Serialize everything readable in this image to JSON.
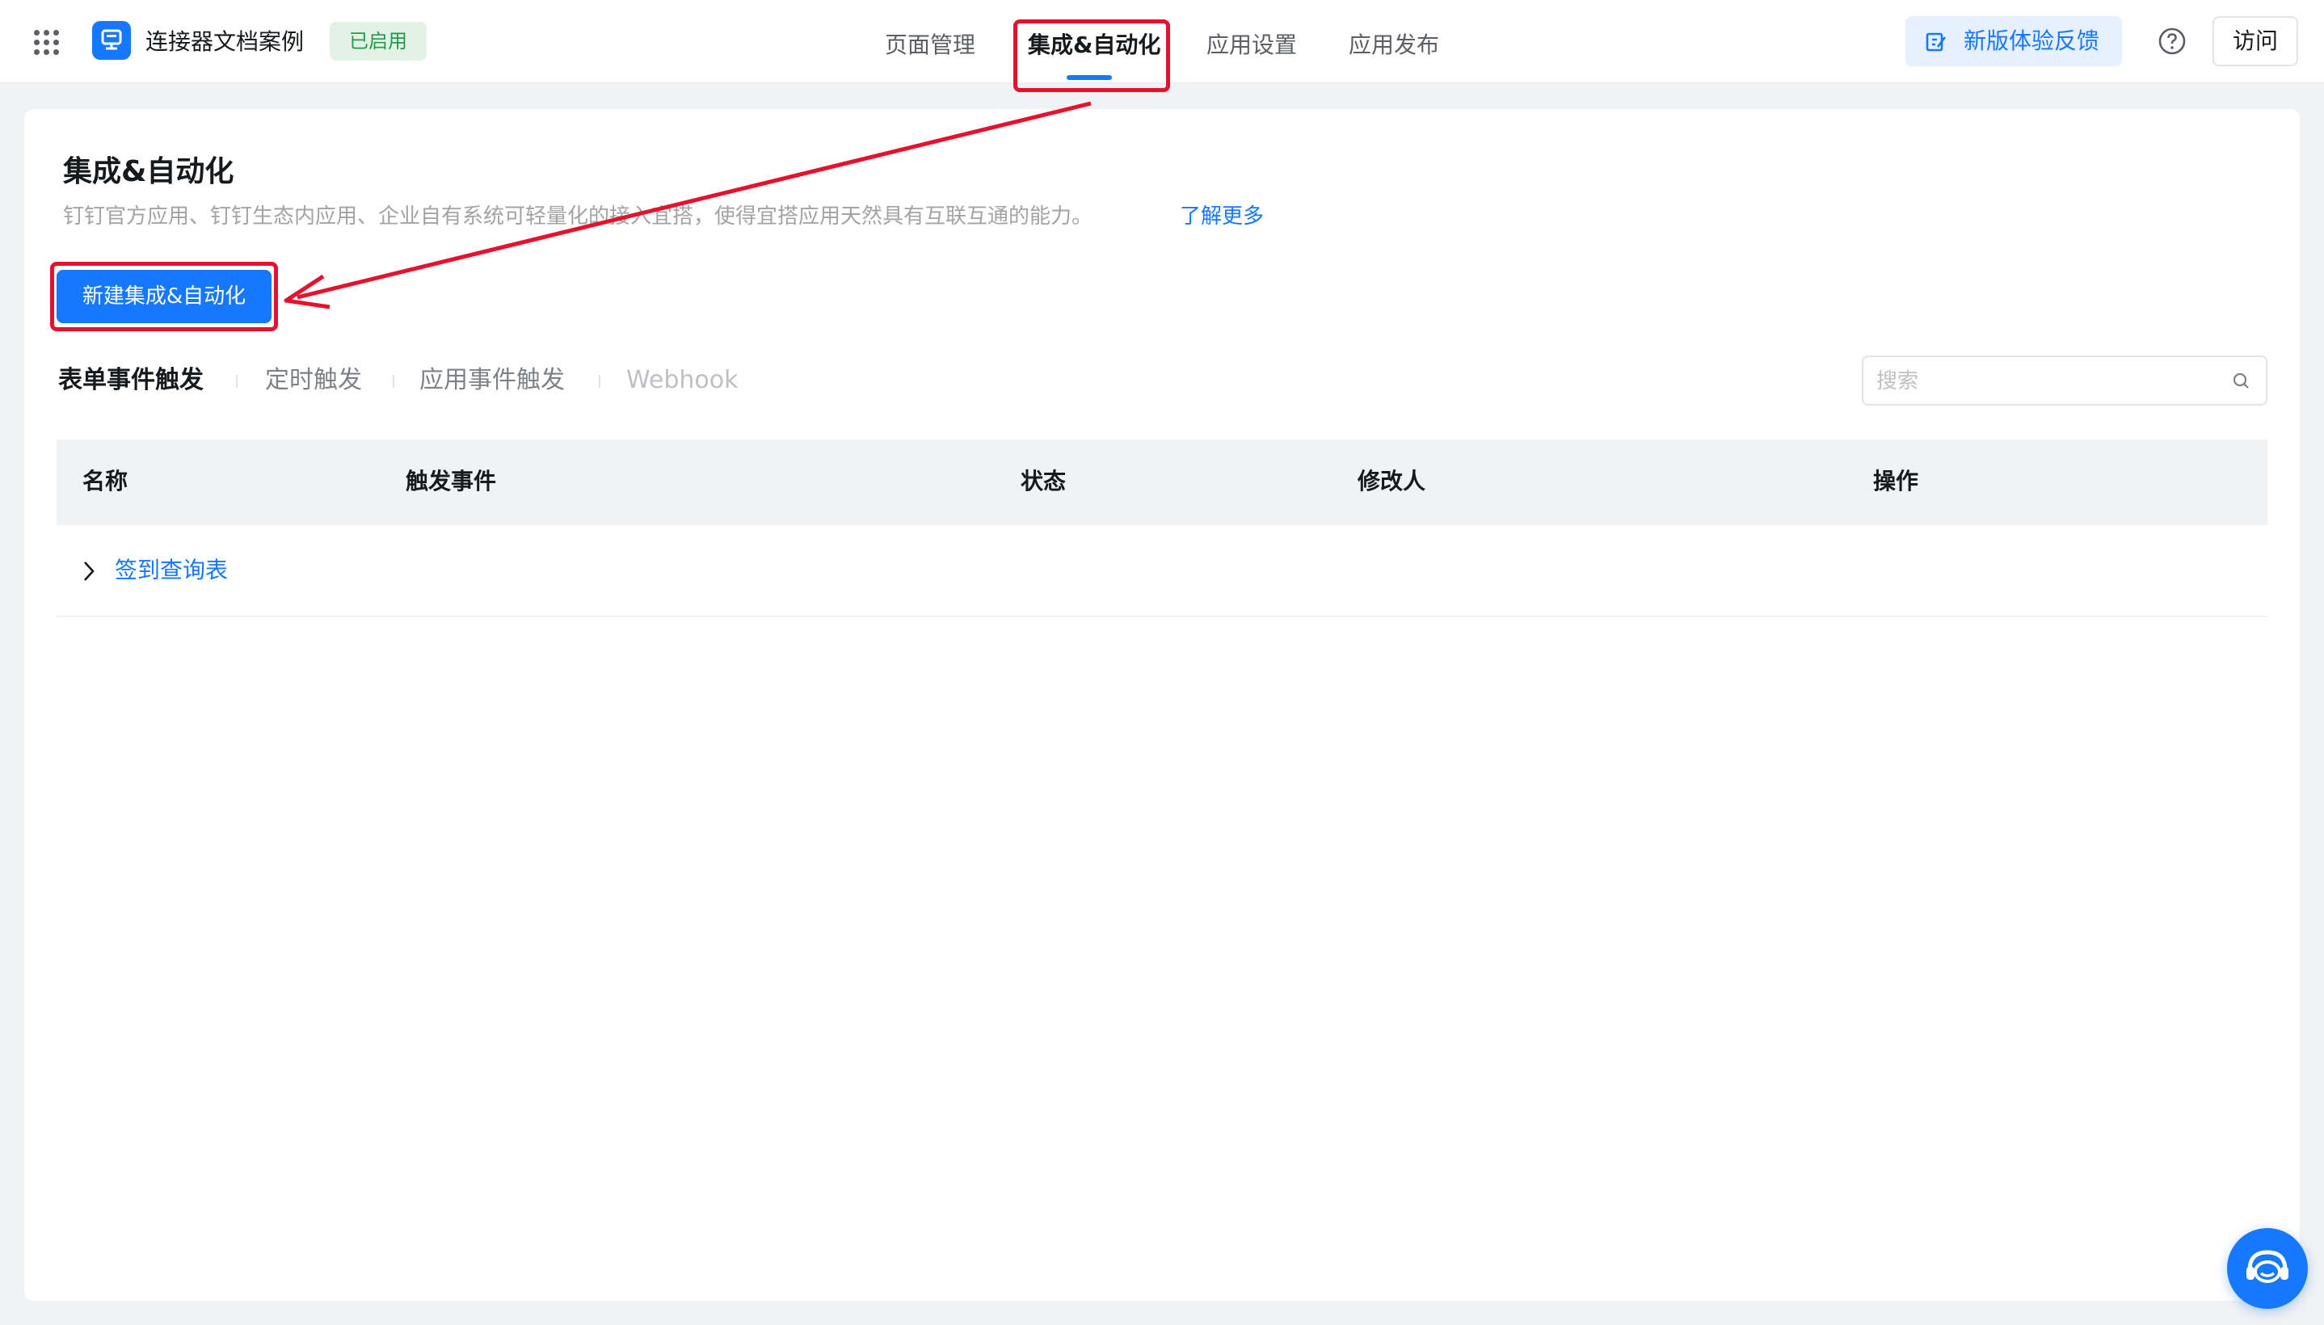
{
  "header": {
    "app_name": "连接器文档案例",
    "status_badge": "已启用",
    "nav_tabs": [
      {
        "label": "页面管理",
        "active": false
      },
      {
        "label": "集成&自动化",
        "active": true
      },
      {
        "label": "应用设置",
        "active": false
      },
      {
        "label": "应用发布",
        "active": false
      }
    ],
    "feedback_label": "新版体验反馈",
    "visit_label": "访问"
  },
  "main": {
    "title": "集成&自动化",
    "description": "钉钉官方应用、钉钉生态内应用、企业自有系统可轻量化的接入宜搭，使得宜搭应用天然具有互联互通的能力。",
    "learn_more": "了解更多",
    "create_button": "新建集成&自动化",
    "sub_tabs": [
      {
        "label": "表单事件触发",
        "state": "active"
      },
      {
        "label": "定时触发",
        "state": "normal"
      },
      {
        "label": "应用事件触发",
        "state": "normal"
      },
      {
        "label": "Webhook",
        "state": "disabled"
      }
    ],
    "search_placeholder": "搜索",
    "table": {
      "columns": [
        "名称",
        "触发事件",
        "状态",
        "修改人",
        "操作"
      ],
      "rows": [
        {
          "name": "签到查询表"
        }
      ]
    }
  },
  "icons": {
    "apps": "grid-icon",
    "app": "app-logo-icon",
    "feedback": "edit-icon",
    "help": "help-icon",
    "search": "search-icon",
    "expand": "chevron-right-icon",
    "support": "customer-service-icon"
  },
  "colors": {
    "accent": "#1677ff",
    "annotation": "#e8112d",
    "badge_bg": "#e2f3e6",
    "badge_text": "#1f9b49"
  }
}
